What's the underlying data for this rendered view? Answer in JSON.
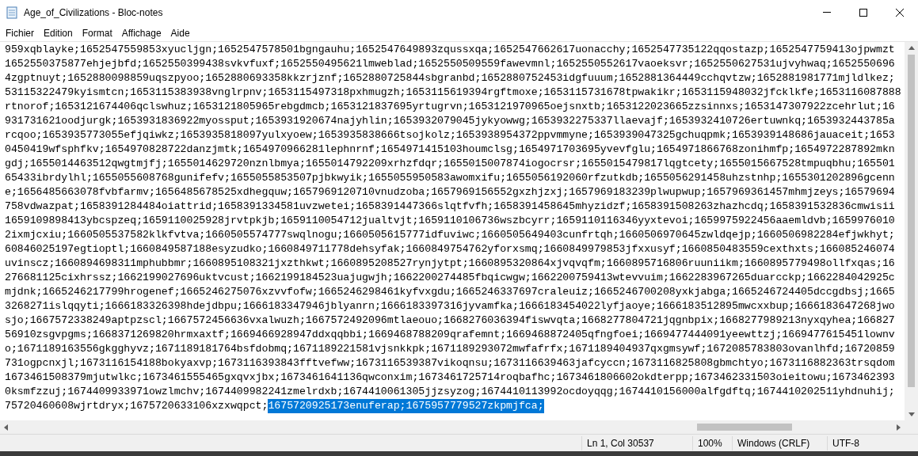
{
  "window": {
    "title": "Age_of_Civilizations - Bloc-notes"
  },
  "menu": [
    {
      "label": "Fichier"
    },
    {
      "label": "Edition"
    },
    {
      "label": "Format"
    },
    {
      "label": "Affichage"
    },
    {
      "label": "Aide"
    }
  ],
  "lines": [
    "959xqblayke;1652547559853xyucljgn;1652547578501bgngauhu;1652547649893zqussxqa;1652547662617uonacchy;1652547735122qqostazp;1652547759413ojpwmzt",
    "1652550375877ehjejbfd;1652550399438svkvfuxf;1652550495621lmweblad;1652550509559fawevmnl;1652550552617vaoeksvr;1652550627531ujvyhwaq;1652550696",
    "4zgptnuyt;1652880098859uqszpyoo;1652880693358kkzrjznf;1652880725844sbgranbd;1652880752453idgfuuum;1652881364449cchqvtzw;1652881981771mjldlkez;",
    "53115322479kyismtcn;1653115383938vnglrpnv;1653115497318pxhmugzh;1653115619394rgftmoxe;1653115731678tpwakikr;1653115948032jfcklkfe;1653116087888",
    "rtnorof;1653121674406qclswhuz;1653121805965rebgdmcb;1653121837695yrtugrvn;1653121970965oejsnxtb;1653122023665zzsinnxs;1653147307922zcehrlut;16",
    "931731621oodjurgk;1653931836922myossput;1653931920674najyhlin;1653932079045jykyowwg;1653932275337llaevajf;1653932410726ertuwnkq;1653932443785a",
    "rcqoo;1653935773055efjqiwkz;1653935818097yulxyoew;1653935838666tsojkolz;1653938954372ppvmmyne;1653939047325gchuqpmk;1653939148686jauaceit;1653",
    "0450419wfsphfkv;1654970828722danzjmtk;1654970966281lephnrnf;1654971415103houmclsg;1654971703695yvevfglu;1654971866768zonihmfp;1654972287892mkn",
    "gdj;1655014463512qwgtmjfj;1655014629720nznlbmya;1655014792209xrhzfdqr;1655015007874iogocrsr;1655015479817lqgtcety;1655015667528tmpuqbhu;165501",
    "65433ibrdylhl;1655055608768gunifefv;1655055853507pjbkwyik;1655055950583awomxifu;1655056192060rfzutkdb;1655056291458uhzstnhp;1655301202896gcenn",
    "e;1656485663078fvbfarmv;1656485678525xdhegquw;1657969120710vnudzoba;1657969156552gxzhjzxj;1657969183239plwupwup;1657969361457mhmjzeys;16579694",
    "758vdwazpat;1658391284484oiattrid;1658391334581uvzwetei;1658391447366slqtfvfh;1658391458645mhyzidzf;1658391508263zhazhcdq;1658391532836cmwisii",
    "1659109898413ybcspzeq;1659110025928jrvtpkjb;1659110054712jualtvjt;1659110106736wszbcyrr;1659110116346yyxtevoi;1659975922456aaemldvb;1659976010",
    "2ixmjcxiu;1660505537582klkfvtva;1660505574777swqlnogu;1660505615777idfuviwc;1660505649403cunfrtqh;1660506970645zwldqejp;1660506982284efjwkhyt;",
    "60846025197egtioptl;1660849587188esyzudko;1660849711778dehsyfak;1660849754762yforxsmq;1660849979853jfxxusyf;1660850483559cexthxts;166085246074",
    "uvinscz;1660894698311mphubbmr;1660895108321jxzthkwt;1660895208527rynjytpt;1660895320864xjvqvqfm;1660895716806ruuniikm;1660895779498ollfxqas;16",
    "276681125cixhrssz;1662199027696uktvcust;1662199184523uajugwjh;1662200274485fbqicwgw;1662200759413wtevvuim;1662283967265duarcckp;1662284042925c",
    "mjdnk;1665246217799hrogenef;1665246275076xzvvfofw;1665246298461kyfvxgdu;1665246337697craleuiz;1665246700208yxkjabga;1665246724405dccgdbsj;1665",
    "3268271islqqyti;1666183326398hdejdbpu;1666183347946jblyanrn;1666183397316jyvamfka;1666183454022lyfjaoye;1666183512895mwcxxbup;1666183647268jwo",
    "sjo;1667572338249aptpzscl;1667572456636vxalwuzh;1667572492096mtlaeouo;1668276036394fiswvqta;1668277804721jqgnbpix;1668277989213nyxqyhea;166827",
    "56910zsgvpgms;1668371269820hrmxaxtf;1669466928947ddxqqbbi;1669468788209qrafemnt;1669468872405qfngfoei;1669477444091yeewttzj;1669477615451lownv",
    "o;1671189163556gkgghyvz;1671189181764bsfdobmq;1671189221581vjsnkkpk;1671189293072mwfafrfx;1671189404937qxgmsywf;1672085783803ovanlhfd;16720859",
    "731ogpcnxjl;1673116154188bokyaxvp;1673116393843fftvefww;1673116539387vikoqnsu;1673116639463jafcyccn;1673116825808gbmchtyo;1673116882363trsqdom",
    "1673461508379mjutwlkc;1673461555465gxqvxjbx;1673461641136qwconxim;1673461725714roqbafhc;1673461806602okdterpp;1673462331503oieitowu;1673462393",
    "0ksmfzzuj;1674409933971owzlmchv;1674409982241zmelrdxb;1674410061305jjzsyzog;1674410113992ocdoyqqg;1674410156000alfgdftq;1674410202511yhdnuhij;",
    "75720460608wjrtdryx;1675720633106xzxwqpct;"
  ],
  "selection": {
    "text": "1675720925173enuferap;1675957779527zkpmjfca;",
    "selected": true
  },
  "status_bar": {
    "position": "Ln 1, Col 30537",
    "zoom": "100%",
    "line_ending": "Windows (CRLF)",
    "encoding": "UTF-8"
  }
}
